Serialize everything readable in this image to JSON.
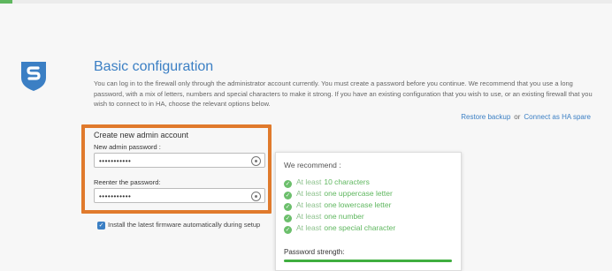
{
  "header": {
    "title": "Basic configuration"
  },
  "intro": "You can log in to the firewall only through the administrator account currently. You must create a password before you continue. We recommend that you use a long password, with a mix of letters, numbers and special characters to make it strong. If you have an existing configuration that you wish to use, or an existing firewall that you wish to connect to in HA, choose the relevant options below.",
  "links": {
    "restore": "Restore backup",
    "or": "or",
    "ha": "Connect as HA spare"
  },
  "form": {
    "section_title": "Create new admin account",
    "new_password_label": "New admin password :",
    "new_password_value": "•••••••••••",
    "reenter_label": "Reenter the password:",
    "reenter_value": "•••••••••••",
    "install_firmware_label": "Install the latest firmware automatically during setup"
  },
  "recommend": {
    "title": "We recommend :",
    "items": [
      {
        "prefix": "At least",
        "value": "10 characters"
      },
      {
        "prefix": "At least",
        "value": "one uppercase letter"
      },
      {
        "prefix": "At least",
        "value": "one lowercase letter"
      },
      {
        "prefix": "At least",
        "value": "one number"
      },
      {
        "prefix": "At least",
        "value": "one special character"
      }
    ],
    "strength_label": "Password strength:",
    "strength_fraction": 1.0
  },
  "colors": {
    "accent": "#3b7fc4",
    "highlight": "#e07a2c",
    "success": "#5fb75f"
  },
  "icons": {
    "logo": "sophos-shield-logo",
    "eye": "eye-icon",
    "check": "check-icon"
  }
}
